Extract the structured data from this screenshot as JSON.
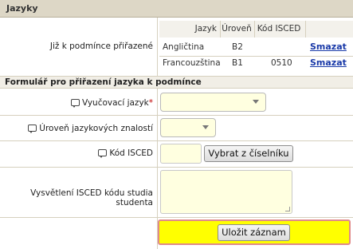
{
  "section_title": "Jazyky",
  "assigned": {
    "label": "Již k podmínce přiřazené",
    "columns": [
      "Jazyk",
      "Úroveň",
      "Kód ISCED"
    ],
    "rows": [
      {
        "language": "Angličtina",
        "level": "B2",
        "isced": "",
        "action": "Smazat"
      },
      {
        "language": "Francouzština",
        "level": "B1",
        "isced": "0510",
        "action": "Smazat"
      }
    ]
  },
  "form": {
    "title": "Formulář pro přiřazení jazyka k podmínce",
    "language_label": "Vyučovací jazyk",
    "required_mark": "*",
    "level_label": "Úroveň jazykových znalostí",
    "isced_label": "Kód ISCED",
    "isced_button": "Vybrat z číselníku",
    "explanation_label": "Vysvětlení ISCED kódu studia studenta",
    "save_button": "Uložit záznam"
  },
  "colors": {
    "header_bg": "#ddd7c6",
    "field_bg": "#ffffe0",
    "save_highlight": "#ffff00",
    "link": "#1a3aa8"
  }
}
